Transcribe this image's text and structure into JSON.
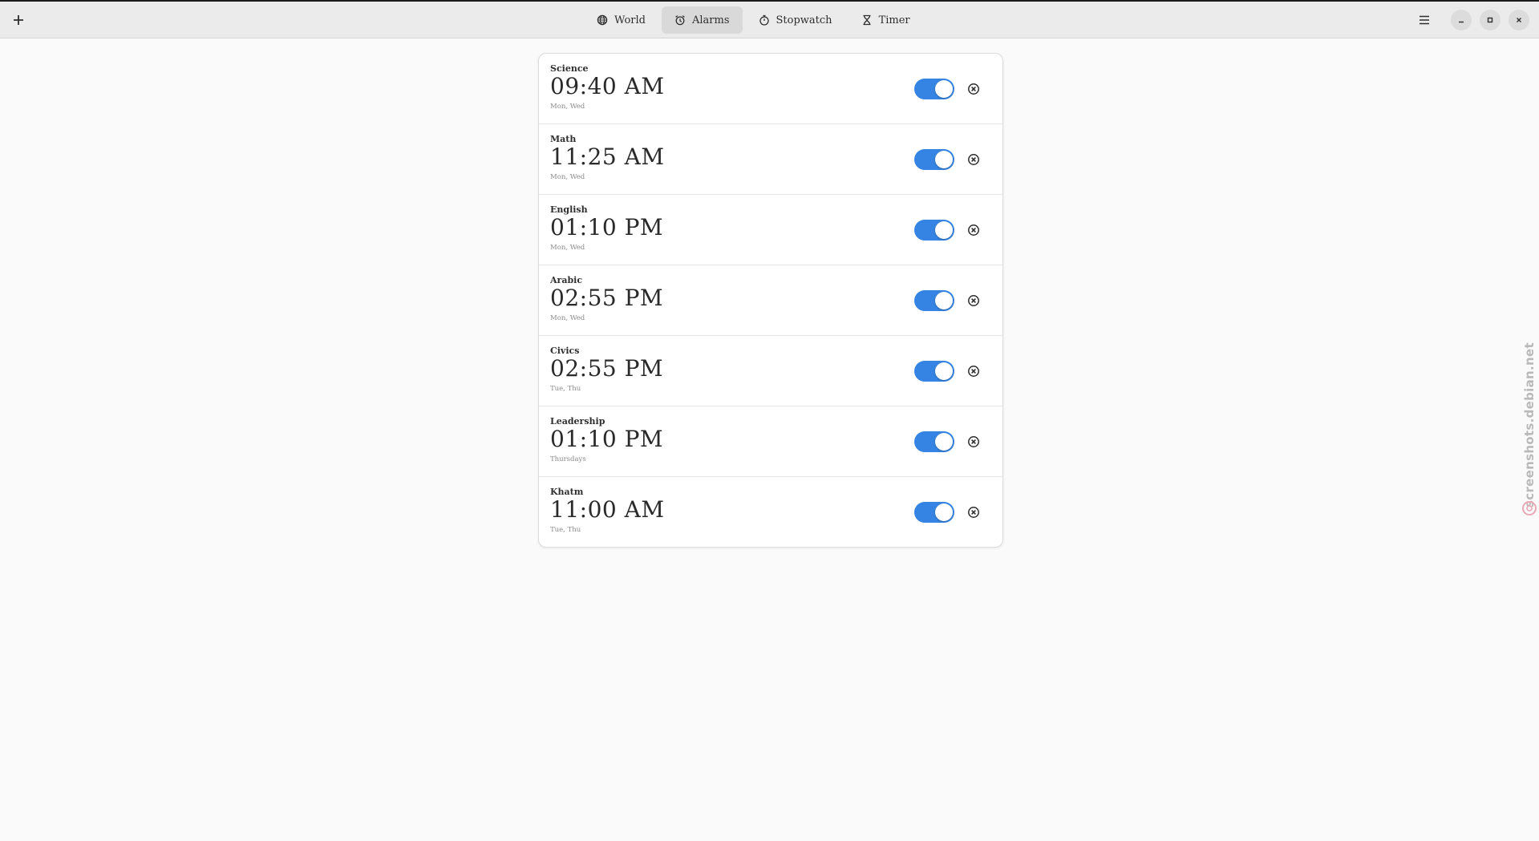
{
  "header": {
    "tabs": [
      {
        "label": "World",
        "icon": "globe-icon",
        "active": false
      },
      {
        "label": "Alarms",
        "icon": "alarm-clock-icon",
        "active": true
      },
      {
        "label": "Stopwatch",
        "icon": "stopwatch-icon",
        "active": false
      },
      {
        "label": "Timer",
        "icon": "hourglass-icon",
        "active": false
      }
    ]
  },
  "alarms": [
    {
      "name": "Science",
      "time": "09:40 AM",
      "days": "Mon, Wed",
      "enabled": true
    },
    {
      "name": "Math",
      "time": "11:25 AM",
      "days": "Mon, Wed",
      "enabled": true
    },
    {
      "name": "English",
      "time": "01:10 PM",
      "days": "Mon, Wed",
      "enabled": true
    },
    {
      "name": "Arabic",
      "time": "02:55 PM",
      "days": "Mon, Wed",
      "enabled": true
    },
    {
      "name": "Civics",
      "time": "02:55 PM",
      "days": "Tue, Thu",
      "enabled": true
    },
    {
      "name": "Leadership",
      "time": "01:10 PM",
      "days": "Thursdays",
      "enabled": true
    },
    {
      "name": "Khatm",
      "time": "11:00 AM",
      "days": "Tue, Thu",
      "enabled": true
    }
  ],
  "colors": {
    "accent": "#3584e4",
    "headerbar": "#ebebeb",
    "background": "#fafafa"
  },
  "watermark": {
    "text": "screenshots.debian.net"
  }
}
